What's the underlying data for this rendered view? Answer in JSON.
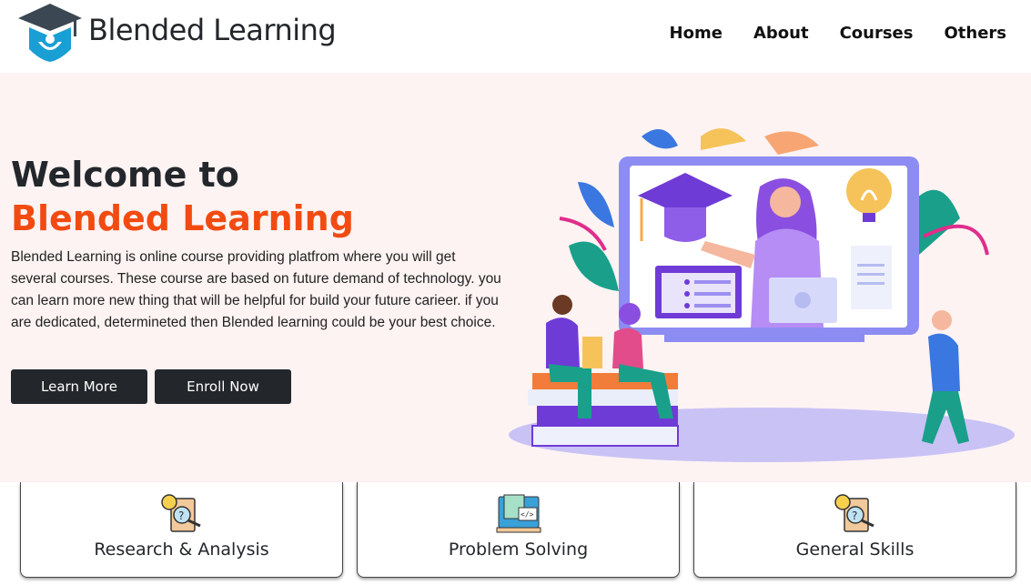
{
  "header": {
    "brand": "Blended Learning",
    "nav": [
      "Home",
      "About",
      "Courses",
      "Others"
    ]
  },
  "hero": {
    "title_line1": "Welcome to",
    "title_line2": "Blended Learning",
    "description": "Blended Learning is online course providing platfrom where you will get several courses. These course are based on future demand of technology. you can learn more new thing that will be helpful for build your future carieer. if you are dedicated, determineted then Blended learning could be your best choice.",
    "learn_more": "Learn More",
    "enroll_now": "Enroll Now"
  },
  "cards": [
    {
      "title": "Research & Analysis",
      "icon": "research-icon"
    },
    {
      "title": "Problem Solving",
      "icon": "code-screen-icon"
    },
    {
      "title": "General Skills",
      "icon": "skills-icon"
    }
  ],
  "colors": {
    "accent": "#f24b12",
    "dark": "#23272b",
    "hero_bg": "#fdf3f3"
  }
}
